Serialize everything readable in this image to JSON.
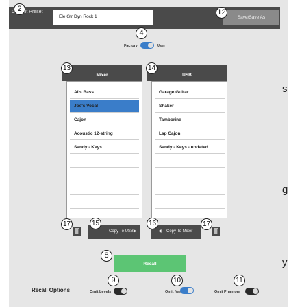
{
  "header": {
    "current_preset_label": "Current Preset",
    "preset_name": "Ele Gtr Dyn Rock 1",
    "save_label": "Save/Save As"
  },
  "source_toggle": {
    "left_label": "Factory",
    "right_label": "User",
    "state": "User"
  },
  "mixer_list": {
    "title": "Mixer",
    "items": [
      "Al's Bass",
      "Joe's Vocal",
      "Cajon",
      "Acoustic 12-string",
      "Sandy - Keys"
    ],
    "selected": "Joe's Vocal"
  },
  "usb_list": {
    "title": "USB",
    "items": [
      "Garage Guitar",
      "Shaker",
      "Tamborine",
      "Lap Cajon",
      "Sandy - Keys - updated"
    ]
  },
  "copy_to_usb_label": "Copy To USB",
  "copy_to_mixer_label": "Copy To Mixer",
  "recall_label": "Recall",
  "recall_options": {
    "title": "Recall Options",
    "omit_levels": {
      "label": "Omit Levels",
      "on": false
    },
    "omit_name": {
      "label": "Omit Name",
      "on": true
    },
    "omit_phantom": {
      "label": "Omit Phantom",
      "on": false
    }
  },
  "callouts": [
    "2",
    "4",
    "12",
    "13",
    "14",
    "15",
    "16",
    "17",
    "17",
    "8",
    "9",
    "10",
    "11"
  ],
  "side_letters": [
    "s",
    "g",
    "y"
  ],
  "colors": {
    "accent_blue": "#3a7dc9",
    "recall_green": "#5cc574",
    "dark_header": "#4a4a4a"
  }
}
